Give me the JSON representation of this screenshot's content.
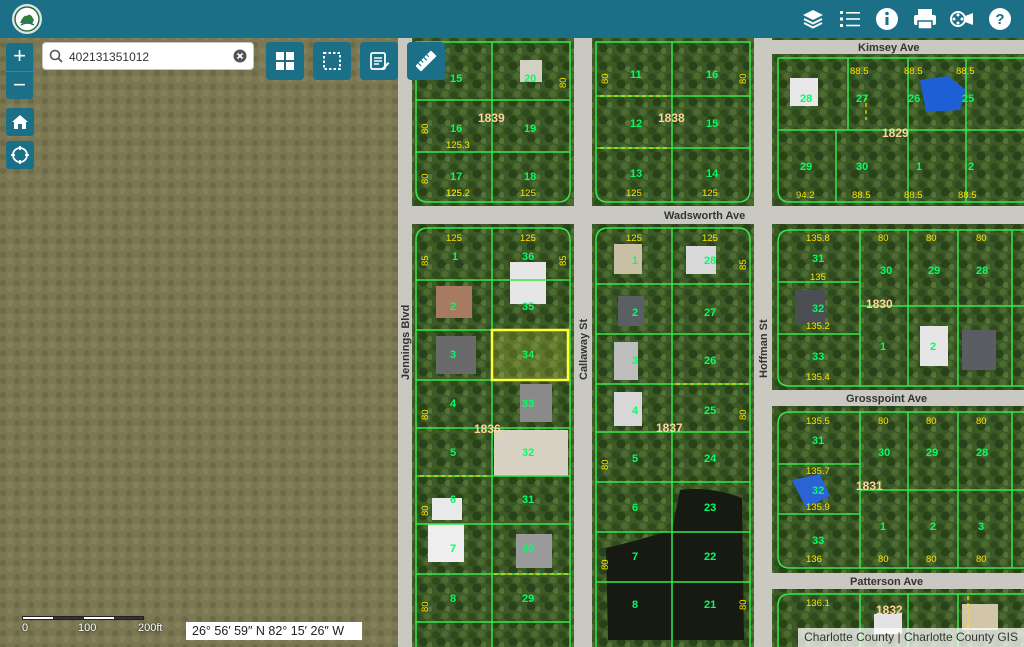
{
  "toolbar": {
    "icons": [
      "layers-icon",
      "legend-list-icon",
      "info-icon",
      "print-icon",
      "film-icon",
      "help-icon"
    ]
  },
  "search": {
    "value": "402131351012",
    "placeholder": ""
  },
  "zoom": {
    "in_label": "+",
    "out_label": "−"
  },
  "tools": [
    "basemap-grid-icon",
    "select-box-icon",
    "edit-form-icon",
    "measure-ruler-icon"
  ],
  "scale": {
    "labels": [
      "0",
      "100",
      "200ft"
    ]
  },
  "coordinates": "26° 56′ 59″ N 82° 15′ 26″ W",
  "attribution": "Charlotte County | Charlotte County GIS",
  "colors": {
    "header": "#1b6f86",
    "parcel_line": "#37e84a",
    "selected_parcel": "#ffff33",
    "block_label": "#ffd59b"
  },
  "streets": {
    "kimsey": "Kimsey Ave",
    "wadsworth": "Wadsworth Ave",
    "grosspoint": "Grosspoint Ave",
    "patterson": "Patterson Ave",
    "jennings": "Jennings Blvd",
    "callaway": "Callaway St",
    "hoffman": "Hoffman St"
  },
  "blocks": [
    "1839",
    "1838",
    "1829",
    "1836",
    "1837",
    "1830",
    "1831",
    "1832"
  ],
  "lots": {
    "b1839": [
      "15",
      "20",
      "16",
      "19",
      "17",
      "18"
    ],
    "b1838": [
      "11",
      "16",
      "12",
      "15",
      "13",
      "14"
    ],
    "b1829": [
      "28",
      "27",
      "26",
      "25",
      "29",
      "30",
      "1",
      "2"
    ],
    "b1836": [
      "1",
      "36",
      "2",
      "35",
      "3",
      "34",
      "4",
      "33",
      "5",
      "32",
      "6",
      "31",
      "7",
      "30",
      "8",
      "29"
    ],
    "b1837": [
      "1",
      "28",
      "2",
      "27",
      "3",
      "26",
      "4",
      "25",
      "5",
      "24",
      "6",
      "23",
      "7",
      "22",
      "8",
      "21"
    ],
    "b1830": [
      "30",
      "29",
      "28",
      "31",
      "32",
      "1",
      "2",
      "33"
    ],
    "b1831": [
      "31",
      "30",
      "29",
      "28",
      "32",
      "1",
      "2",
      "3",
      "33"
    ],
    "b1832": []
  },
  "dims": [
    "88.5",
    "125.3",
    "125.2",
    "125",
    "94.2",
    "135.8",
    "135",
    "135.2",
    "135.4",
    "135.5",
    "135.7",
    "135.9",
    "136",
    "136.1",
    "80",
    "85"
  ],
  "selected_lot": "34"
}
